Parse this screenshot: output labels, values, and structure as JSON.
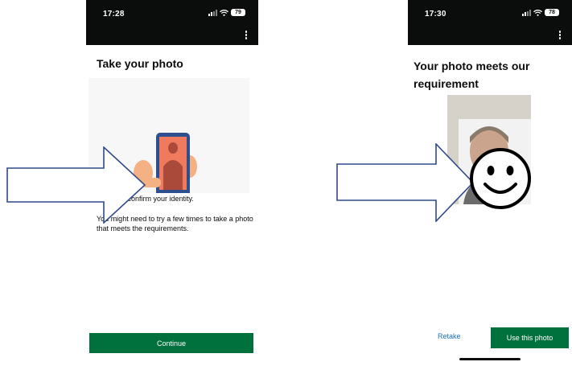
{
  "left_screen": {
    "status": {
      "time": "17:28",
      "battery": "79"
    },
    "title": "Take your photo",
    "para1": "This is to confirm your identity.",
    "para2": "You might need to try a few times to take a photo that meets the requirements.",
    "continue_label": "Continue"
  },
  "right_screen": {
    "status": {
      "time": "17:30",
      "battery": "78"
    },
    "title": "Your photo meets our requirement",
    "retake_label": "Retake",
    "use_photo_label": "Use this photo"
  },
  "colors": {
    "status_bar": "#0b0c0c",
    "primary_button": "#00703c",
    "link": "#1d70b8",
    "illustration_shirt": "#f07a5e",
    "annotation_arrow": "#2f4a8a"
  },
  "icons": [
    "signal-icon",
    "wifi-icon",
    "battery-icon",
    "more-options-icon",
    "arrow-annotation-icon",
    "smiley-face-icon"
  ]
}
